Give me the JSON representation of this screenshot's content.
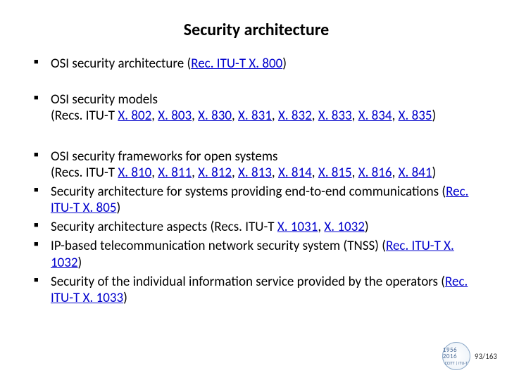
{
  "title": "Security architecture",
  "bullets": {
    "b1_pre": "OSI security architecture (",
    "b1_link": "Rec. ITU-T X. 800",
    "b1_post": ")",
    "b2_pre": "OSI security models\n(Recs. ITU-T ",
    "b2_l1": "X. 802",
    "b2_c": ", ",
    "b2_l2": "X. 803",
    "b2_l3": "X. 830",
    "b2_l4": "X. 831",
    "b2_l5": "X. 832",
    "b2_l6": "X. 833",
    "b2_l7": "X. 834",
    "b2_l8": "X. 835",
    "b2_post": ")",
    "b3_pre": "OSI security frameworks for open systems\n(Recs. ITU-T ",
    "b3_l1": "X. 810",
    "b3_l2": "X. 811",
    "b3_l3": "X. 812",
    "b3_l4": "X. 813",
    "b3_l5": "X. 814",
    "b3_l6": "X. 815",
    "b3_l7": "X. 816",
    "b3_l8": "X. 841",
    "b3_post": ")",
    "b4_pre": "Security architecture for systems providing end-to-end communications (",
    "b4_link": "Rec. ITU-T X. 805",
    "b4_post": ")",
    "b5_pre": "Security architecture aspects (Recs. ITU-T ",
    "b5_l1": "X. 1031",
    "b5_l2": "X. 1032",
    "b5_post": ")",
    "b6_pre": "IP-based telecommunication network security system (TNSS) (",
    "b6_link": "Rec. ITU-T X. 1032",
    "b6_post": ")",
    "b7_pre": "Security of the individual information service provided by the operators (",
    "b7_link": "Rec. ITU-T X. 1033",
    "b7_post": ")"
  },
  "badge": {
    "years": "1956 2016",
    "label": "CCITT | ITU-T"
  },
  "pager": "93/163"
}
